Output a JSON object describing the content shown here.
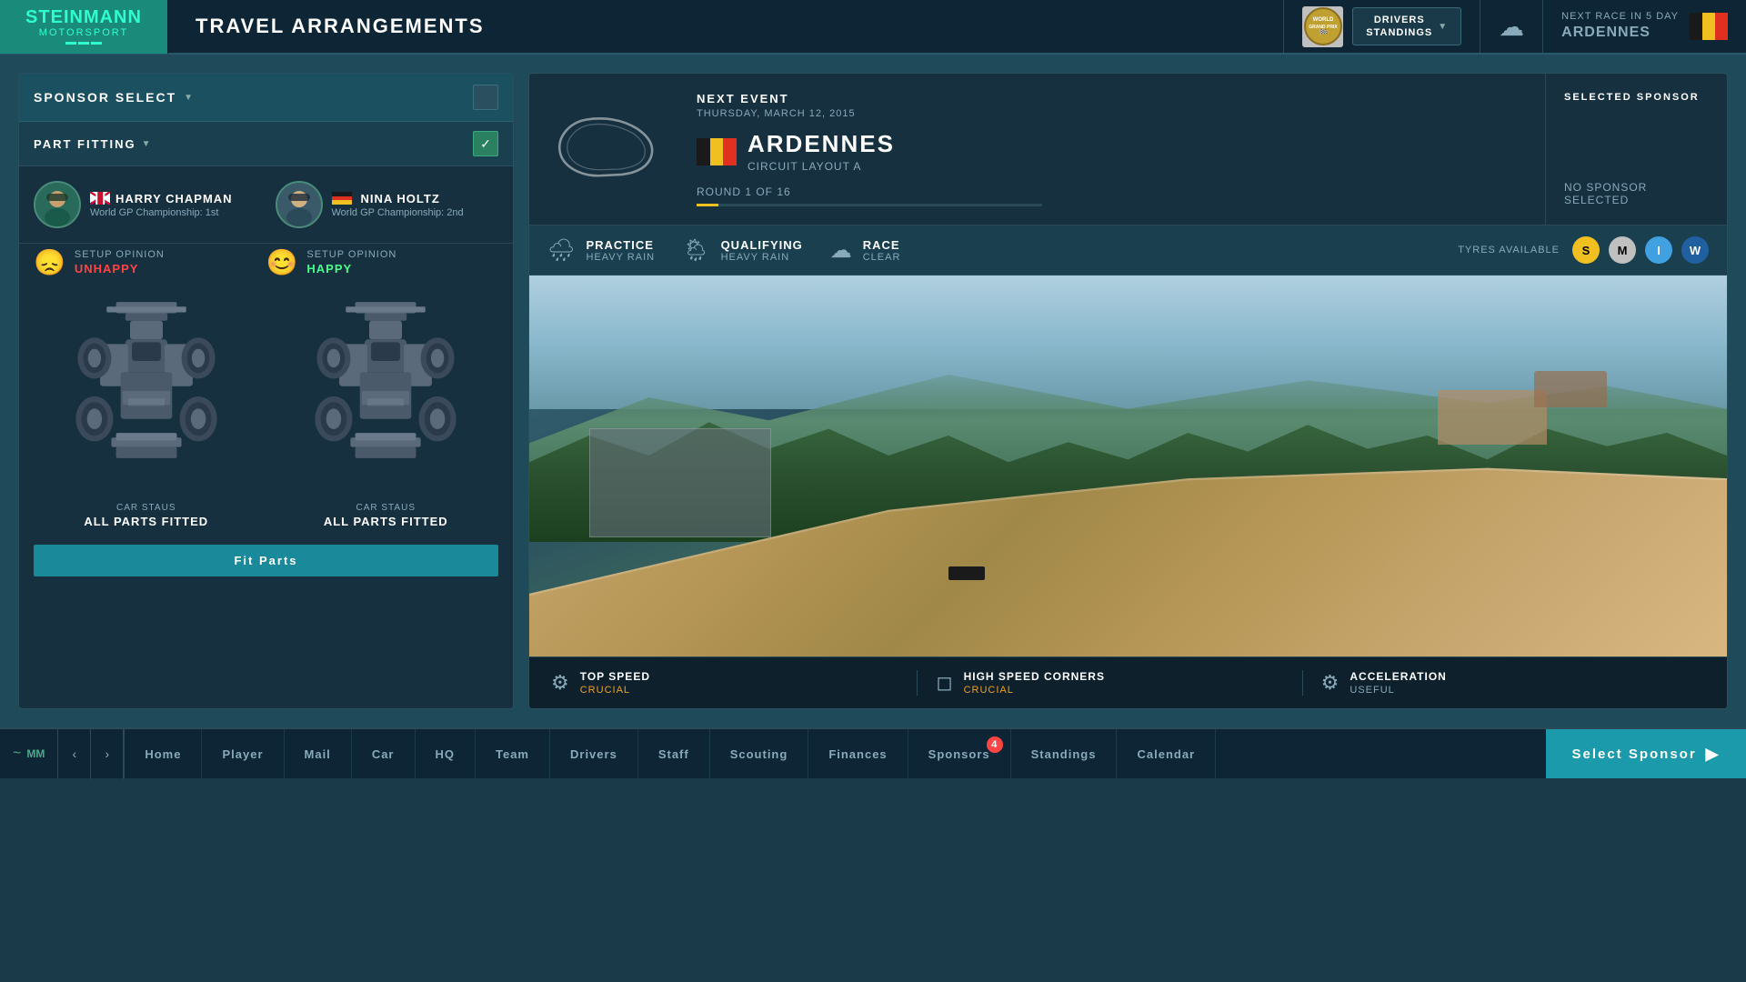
{
  "header": {
    "logo_main": "STEINMANN",
    "logo_sub": "MOTORSPORT",
    "page_title": "TRAVEL ARRANGEMENTS",
    "world_gp_label": "WORLD\nGRAND PRIX",
    "drivers_standings": "DRIVERS\nSTANDINGS",
    "next_race_prefix": "NEXT RACE IN 5 DAY",
    "next_race_location": "ARDENNES"
  },
  "left_panel": {
    "sponsor_select_label": "SPONSOR SELECT",
    "part_fitting_label": "PART FITTING",
    "driver1": {
      "name": "HARRY CHAPMAN",
      "flag": "UK",
      "championship": "World GP Championship: 1st",
      "setup_opinion_label": "SETUP OPINION",
      "setup_opinion_value": "UNHAPPY",
      "car_status_label": "CAR STAUS",
      "car_status_value": "ALL PARTS FITTED"
    },
    "driver2": {
      "name": "NINA HOLTZ",
      "flag": "DE",
      "championship": "World GP Championship: 2nd",
      "setup_opinion_label": "SETUP OPINION",
      "setup_opinion_value": "HAPPY",
      "car_status_label": "CAR STAUS",
      "car_status_value": "ALL PARTS FITTED"
    },
    "fit_parts_btn": "Fit Parts"
  },
  "right_panel": {
    "next_event_label": "NEXT EVENT",
    "event_date": "THURSDAY, MARCH 12, 2015",
    "event_name": "ARDENNES",
    "circuit_name": "CIRCUIT LAYOUT A",
    "round_label": "ROUND 1 OF 16",
    "selected_sponsor_label": "SELECTED SPONSOR",
    "no_sponsor_text": "NO SPONSOR SELECTED",
    "weather": {
      "practice_label": "PRACTICE",
      "practice_condition": "HEAVY RAIN",
      "qualifying_label": "QUALIFYING",
      "qualifying_condition": "HEAVY RAIN",
      "race_label": "RACE",
      "race_condition": "CLEAR",
      "tyres_label": "TYRES AVAILABLE",
      "tyre_s": "S",
      "tyre_m": "M",
      "tyre_i": "I",
      "tyre_w": "W"
    },
    "characteristics": [
      {
        "name": "TOP SPEED",
        "value": "CRUCIAL",
        "type": "crucial"
      },
      {
        "name": "HIGH SPEED CORNERS",
        "value": "CRUCIAL",
        "type": "crucial"
      },
      {
        "name": "ACCELERATION",
        "value": "USEFUL",
        "type": "useful"
      }
    ]
  },
  "nav": {
    "items": [
      {
        "label": "Home",
        "badge": null
      },
      {
        "label": "Player",
        "badge": null
      },
      {
        "label": "Mail",
        "badge": null
      },
      {
        "label": "Car",
        "badge": null
      },
      {
        "label": "HQ",
        "badge": null
      },
      {
        "label": "Team",
        "badge": null
      },
      {
        "label": "Drivers",
        "badge": null
      },
      {
        "label": "Staff",
        "badge": null
      },
      {
        "label": "Scouting",
        "badge": null
      },
      {
        "label": "Finances",
        "badge": null
      },
      {
        "label": "Sponsors",
        "badge": 4
      },
      {
        "label": "Standings",
        "badge": null
      },
      {
        "label": "Calendar",
        "badge": null
      }
    ],
    "select_sponsor_btn": "Select Sponsor"
  }
}
